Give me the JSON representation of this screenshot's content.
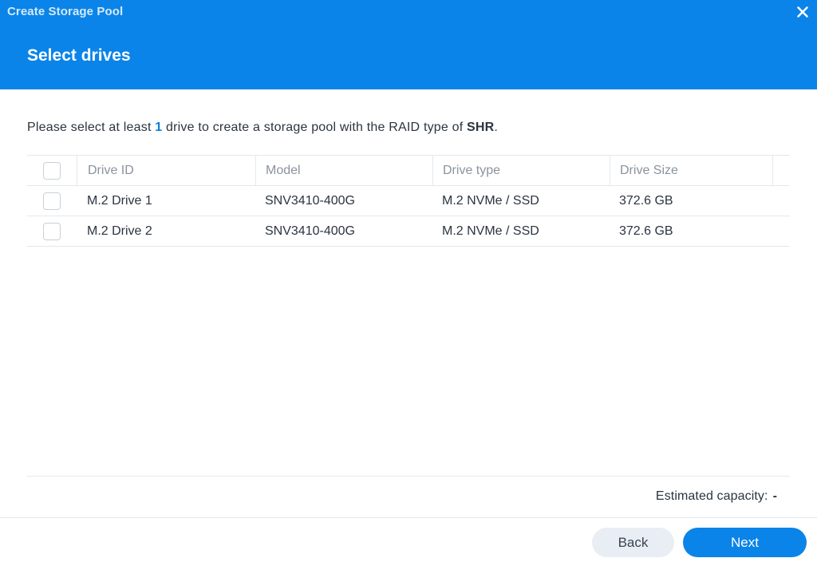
{
  "window": {
    "title": "Create Storage Pool"
  },
  "step": {
    "title": "Select drives"
  },
  "instruction": {
    "prefix": "Please select at least ",
    "count": "1",
    "middle": " drive to create a storage pool with the RAID type of ",
    "raid_type": "SHR",
    "suffix": "."
  },
  "table": {
    "columns": [
      "Drive ID",
      "Model",
      "Drive type",
      "Drive Size"
    ],
    "rows": [
      {
        "id": "M.2 Drive 1",
        "model": "SNV3410-400G",
        "type": "M.2 NVMe / SSD",
        "size": "372.6 GB"
      },
      {
        "id": "M.2 Drive 2",
        "model": "SNV3410-400G",
        "type": "M.2 NVMe / SSD",
        "size": "372.6 GB"
      }
    ]
  },
  "capacity": {
    "label": "Estimated capacity:",
    "value": "-"
  },
  "buttons": {
    "back": "Back",
    "next": "Next"
  },
  "icons": {
    "close": "close-icon"
  },
  "colors": {
    "accent": "#0a84e8",
    "header_bg": "#0a84e8",
    "highlight_text": "#0a7fe0"
  }
}
